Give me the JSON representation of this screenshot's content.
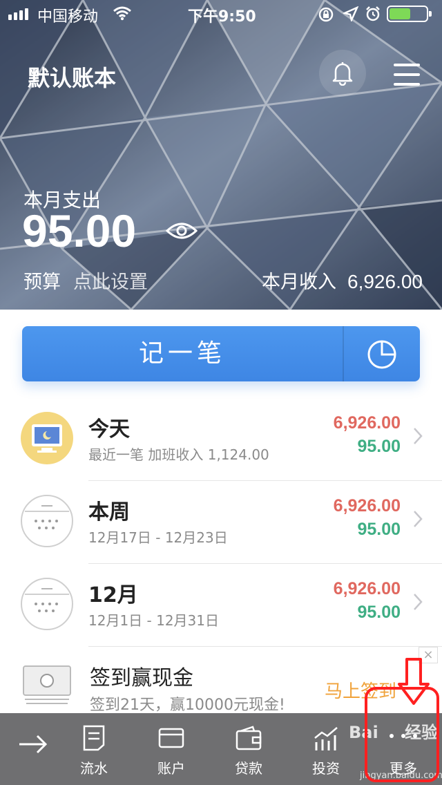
{
  "status_bar": {
    "carrier": "中国移动",
    "time": "下午9:50",
    "battery_color": "#7ed957"
  },
  "header": {
    "book_title": "默认账本",
    "bell_icon": "bell-icon",
    "menu_icon": "hamburger-menu-icon",
    "spend_label": "本月支出",
    "spend_value": "95.00",
    "budget_label": "预算",
    "budget_link": "点此设置",
    "income_label": "本月收入",
    "income_value": "6,926.00"
  },
  "record_button": {
    "label": "记一笔",
    "chart_icon": "pie-chart-icon",
    "color": "#4a92ea"
  },
  "rows": [
    {
      "title": "今天",
      "sub": "最近一笔 加班收入 1,124.00",
      "income": "6,926.00",
      "expense": "95.00"
    },
    {
      "title": "本周",
      "sub": "12月17日 - 12月23日",
      "income": "6,926.00",
      "expense": "95.00"
    },
    {
      "title": "12月",
      "sub": "12月1日 - 12月31日",
      "income": "6,926.00",
      "expense": "95.00"
    }
  ],
  "colors": {
    "income": "#e0685f",
    "expense": "#3fae84",
    "cta": "#f0a23a",
    "toolbar": "#6f6f71",
    "annotation": "#ff2020"
  },
  "promo": {
    "title": "签到赢现金",
    "sub": "签到21天，赢10000元现金!",
    "cta": "马上签到",
    "close": "×"
  },
  "toolbar": {
    "items": [
      {
        "label": "",
        "icon": "arrow-right-icon"
      },
      {
        "label": "流水",
        "icon": "document-icon"
      },
      {
        "label": "账户",
        "icon": "card-icon"
      },
      {
        "label": "贷款",
        "icon": "wallet-icon"
      },
      {
        "label": "投资",
        "icon": "chart-icon"
      },
      {
        "label": "更多",
        "icon": "more-dots-icon"
      }
    ]
  },
  "watermark": {
    "brand": "Bai",
    "extra": "经验",
    "url": "jingyan.baidu.com"
  }
}
